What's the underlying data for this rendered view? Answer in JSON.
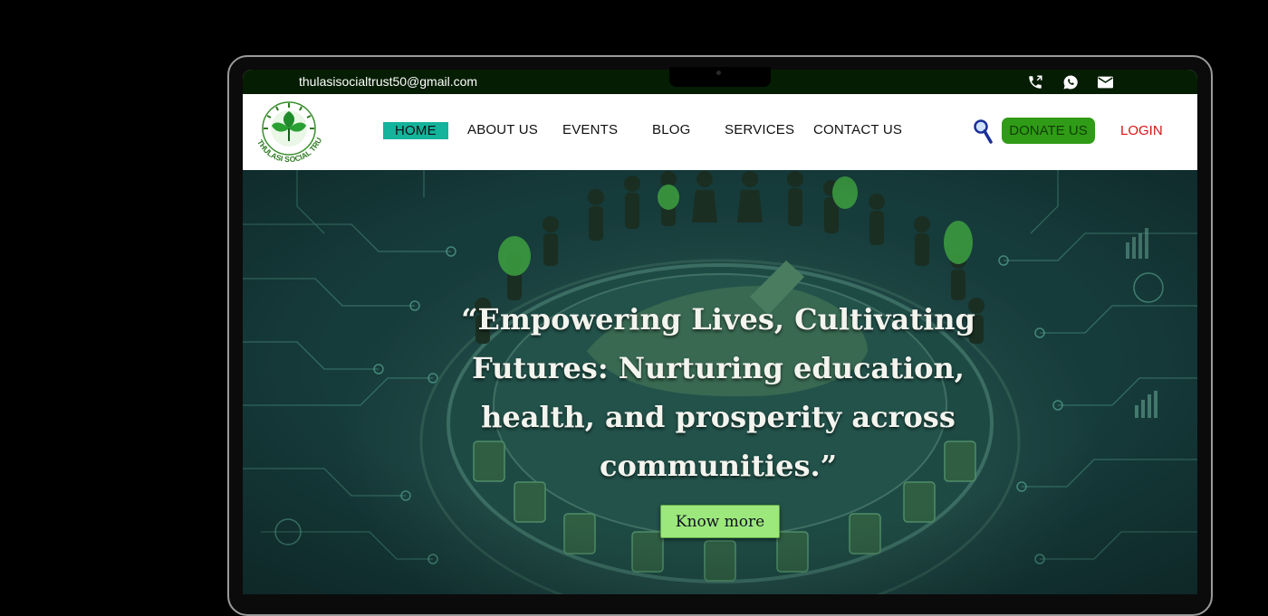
{
  "topbar": {
    "email": "thulasisocialtrust50@gmail.com",
    "icons": [
      "phone-icon",
      "whatsapp-icon",
      "mail-icon"
    ]
  },
  "brand": {
    "logo_text": "THULASI SOCIAL TRUST",
    "logo_icon": "leaf-emblem-icon"
  },
  "nav": {
    "home": "HOME",
    "about": "ABOUT US",
    "events": "EVENTS",
    "blog": "BLOG",
    "services": "SERVICES",
    "contact": "CONTACT US",
    "search_icon": "search-icon",
    "donate": "DONATE US",
    "login": "LOGIN"
  },
  "hero": {
    "headline": "“Empowering Lives, Cultivating Futures: Nurturing education, health, and prosperity across communities.”",
    "cta": "Know more"
  },
  "colors": {
    "topbar_bg": "#051d03",
    "home_active": "#14b39b",
    "donate_bg": "#2f9b16",
    "login": "#d61414",
    "cta_bg": "#9de87c"
  }
}
